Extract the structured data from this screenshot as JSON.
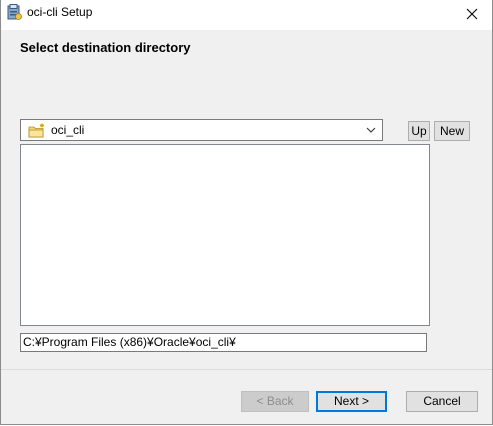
{
  "window": {
    "title": "oci-cli Setup",
    "close_glyph": "✕"
  },
  "page": {
    "heading": "Select destination directory"
  },
  "folder_combo": {
    "selected": "oci_cli",
    "icon": "new-folder-icon"
  },
  "buttons": {
    "up": "Up",
    "new": "New",
    "back": "< Back",
    "next": "Next >",
    "cancel": "Cancel"
  },
  "path": {
    "value": "C:¥Program Files (x86)¥Oracle¥oci_cli¥"
  },
  "colors": {
    "accent": "#0078d7",
    "dialog_bg": "#f0f0f0",
    "button_bg": "#e1e1e1"
  }
}
